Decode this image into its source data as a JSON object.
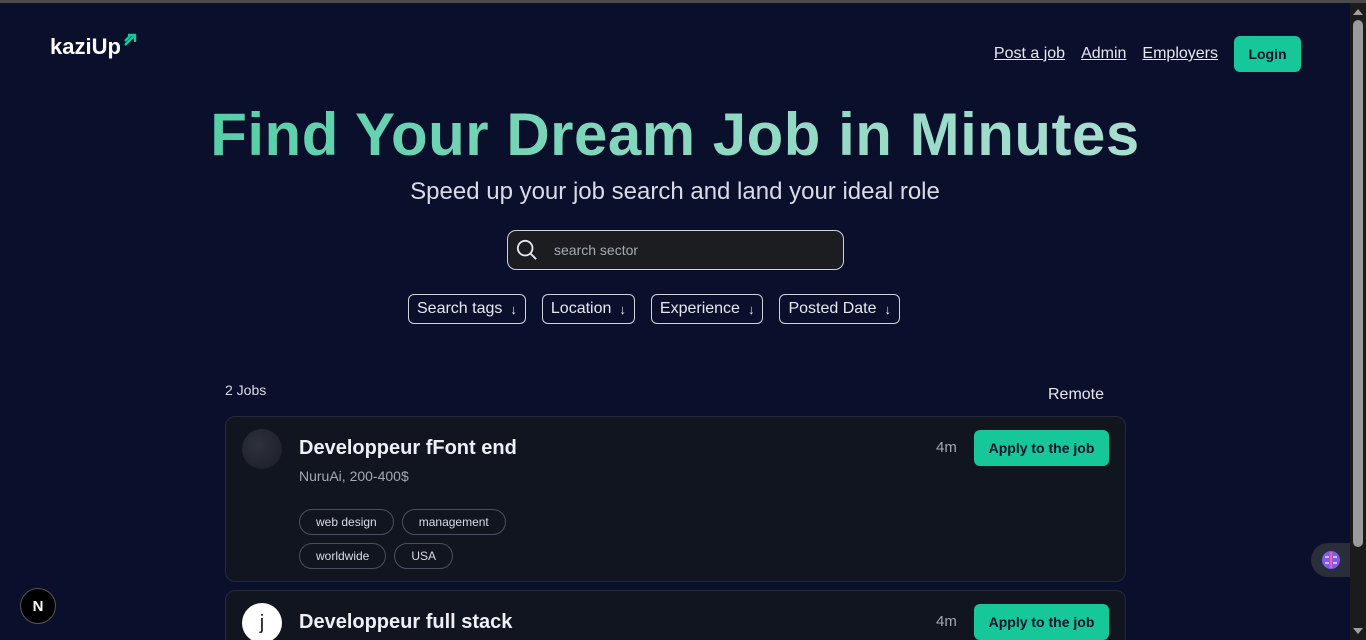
{
  "header": {
    "logo_text": "kaziUp",
    "nav": [
      "Post a job",
      "Admin",
      "Employers"
    ],
    "login_label": "Login"
  },
  "hero": {
    "title": "Find Your Dream Job in Minutes",
    "subtitle": "Speed up your job search and land your ideal role"
  },
  "search": {
    "placeholder": "search sector",
    "value": ""
  },
  "filters": [
    "Search tags",
    "Location",
    "Experience",
    "Posted Date"
  ],
  "results": {
    "count_label": "2 Jobs",
    "remote_label": "Remote"
  },
  "jobs": [
    {
      "title": "Developpeur fFont end",
      "company": "NuruAi, 200-400$",
      "age": "4m",
      "apply_label": "Apply to the job",
      "tags": [
        "web design",
        "management",
        "worldwide",
        "USA"
      ]
    },
    {
      "title": "Developpeur full stack",
      "avatar_letter": "j",
      "age": "4m",
      "apply_label": "Apply to the job"
    }
  ],
  "dev_badge": "N",
  "colors": {
    "background": "#0a0f2c",
    "accent": "#16c79a",
    "card": "#111520"
  },
  "icons": [
    "search-icon",
    "chevron-down-icon",
    "logo-arrow-icon",
    "brain-extension-icon"
  ]
}
